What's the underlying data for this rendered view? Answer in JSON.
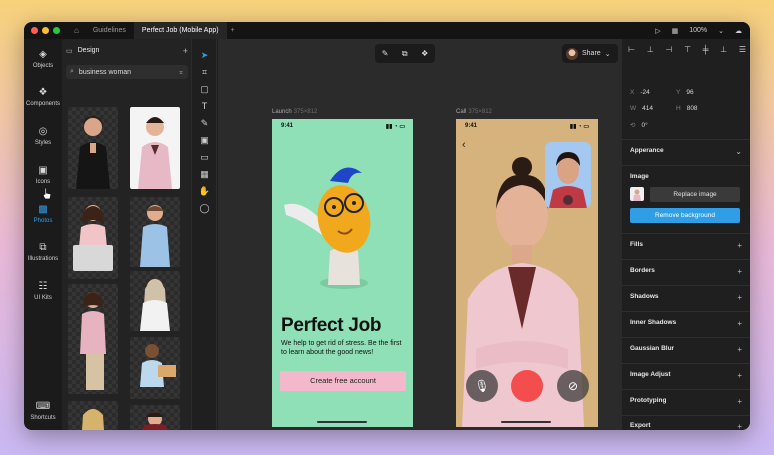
{
  "titlebar": {
    "tabs": [
      {
        "label": "Guidelines",
        "active": false
      },
      {
        "label": "Perfect Job (Mobile App)",
        "active": true
      }
    ],
    "zoom": "100%",
    "icons": [
      "home-icon",
      "play-icon",
      "grid-icon",
      "chevron-down-icon",
      "cloud-icon"
    ]
  },
  "leftrail": {
    "items": [
      {
        "label": "Objects",
        "icon": "layers-icon",
        "active": false
      },
      {
        "label": "Components",
        "icon": "components-icon",
        "active": false
      },
      {
        "label": "Styles",
        "icon": "palette-icon",
        "active": false
      },
      {
        "label": "Icons",
        "icon": "icons-icon",
        "active": false
      },
      {
        "label": "Photos",
        "icon": "photo-icon",
        "active": true
      },
      {
        "label": "Illustrations",
        "icon": "illustration-icon",
        "active": false
      },
      {
        "label": "UI Kits",
        "icon": "ui-kit-icon",
        "active": false
      }
    ],
    "bottom": {
      "label": "Shortcuts",
      "icon": "keyboard-icon"
    }
  },
  "assets": {
    "section": "Design",
    "search_value": "business woman"
  },
  "canvas": {
    "share_label": "Share",
    "frames": [
      {
        "name": "Launch",
        "size": "375×812"
      },
      {
        "name": "Call",
        "size": "375×812"
      }
    ]
  },
  "launch_screen": {
    "time": "9:41",
    "title": "Perfect Job",
    "body": "We help to get rid of stress. Be the first to learn about the good news!",
    "cta": "Create free account",
    "bg_color": "#8fe0b7",
    "cta_color": "#f3b8cc"
  },
  "call_screen": {
    "time": "9:41",
    "bg_color": "#d6b37d",
    "end_call_color": "#f44d4d"
  },
  "properties": {
    "x_label": "X",
    "x_value": "-24",
    "y_label": "Y",
    "y_value": "96",
    "w_label": "W",
    "w_value": "414",
    "h_label": "H",
    "h_value": "808",
    "rotation": "0°",
    "appearance": "Apperance",
    "image_label": "Image",
    "replace_image": "Replace image",
    "remove_background": "Remove background",
    "sections": [
      "Fills",
      "Borders",
      "Shadows",
      "Inner Shadows",
      "Gaussian Blur",
      "Image Adjust",
      "Prototyping",
      "Export"
    ],
    "accent": "#2f9ee6"
  }
}
